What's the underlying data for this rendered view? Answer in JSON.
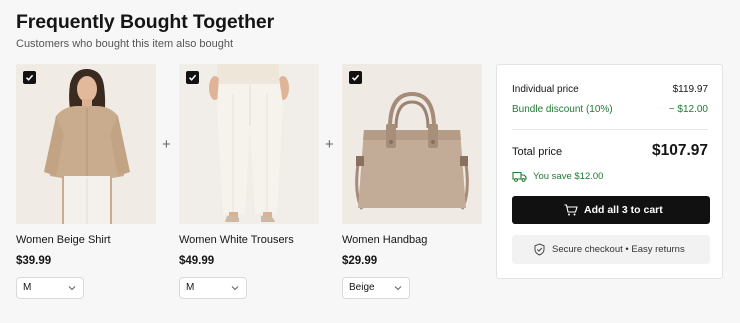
{
  "header": {
    "title": "Frequently Bought Together",
    "subtitle": "Customers who bought this item also bought"
  },
  "products": [
    {
      "name": "Women Beige Shirt",
      "price": "$39.99",
      "option": "M",
      "checked": true
    },
    {
      "name": "Women White Trousers",
      "price": "$49.99",
      "option": "M",
      "checked": true
    },
    {
      "name": "Women Handbag",
      "price": "$29.99",
      "option": "Beige",
      "checked": true
    }
  ],
  "separator": "+",
  "summary": {
    "individual_label": "Individual price",
    "individual_value": "$119.97",
    "discount_label": "Bundle discount (10%)",
    "discount_value": "− $12.00",
    "total_label": "Total price",
    "total_value": "$107.97",
    "savings": "You save $12.00",
    "cart_button": "Add all 3 to cart",
    "secure_text": "Secure checkout • Easy returns"
  },
  "colors": {
    "accent_green": "#1f7a34",
    "button_bg": "#111111"
  },
  "icons": [
    "check-icon",
    "chevron-down-icon",
    "truck-icon",
    "cart-icon",
    "shield-icon"
  ]
}
